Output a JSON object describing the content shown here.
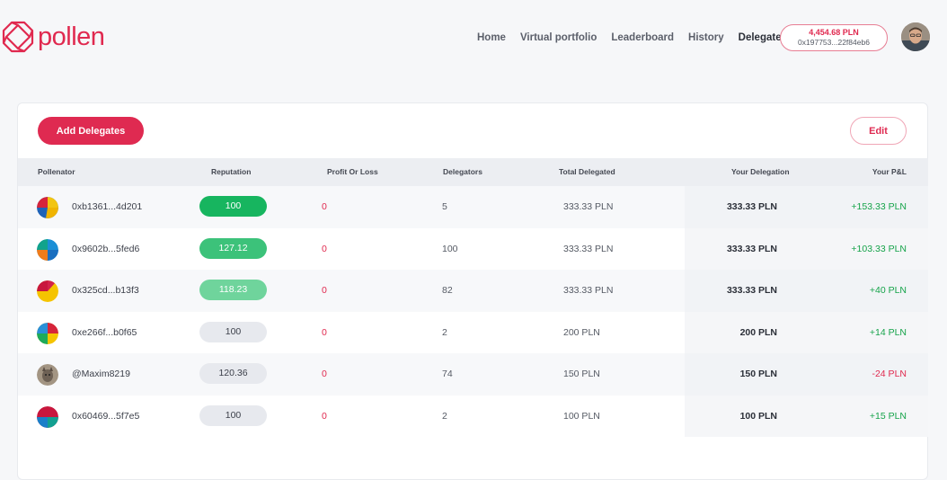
{
  "brand": {
    "name": "pollen",
    "color": "#e0294f"
  },
  "nav": [
    {
      "label": "Home",
      "active": false
    },
    {
      "label": "Virtual portfolio",
      "active": false
    },
    {
      "label": "Leaderboard",
      "active": false
    },
    {
      "label": "History",
      "active": false
    },
    {
      "label": "Delegate",
      "active": true
    }
  ],
  "wallet": {
    "balance": "4,454.68 PLN",
    "address": "0x197753...22f84eb6"
  },
  "toolbar": {
    "add_label": "Add Delegates",
    "edit_label": "Edit"
  },
  "table": {
    "headers": {
      "pollenator": "Pollenator",
      "reputation": "Reputation",
      "pnl": "Profit Or Loss",
      "delegators": "Delegators",
      "total": "Total Delegated",
      "your_delegation": "Your Delegation",
      "your_pnl": "Your P&L"
    },
    "rows": [
      {
        "name": "0xb1361...4d201",
        "reputation": "100",
        "rep_level": "high",
        "pnl": "0",
        "delegators": "5",
        "total": "333.33 PLN",
        "your_delegation": "333.33 PLN",
        "your_pnl": "+153.33 PLN",
        "trend": "pos",
        "avatar": "pie-a"
      },
      {
        "name": "0x9602b...5fed6",
        "reputation": "127.12",
        "rep_level": "mid",
        "pnl": "0",
        "delegators": "100",
        "total": "333.33 PLN",
        "your_delegation": "333.33 PLN",
        "your_pnl": "+103.33 PLN",
        "trend": "pos",
        "avatar": "pie-b"
      },
      {
        "name": "0x325cd...b13f3",
        "reputation": "118.23",
        "rep_level": "low",
        "pnl": "0",
        "delegators": "82",
        "total": "333.33 PLN",
        "your_delegation": "333.33 PLN",
        "your_pnl": "+40 PLN",
        "trend": "pos",
        "avatar": "pie-c"
      },
      {
        "name": "0xe266f...b0f65",
        "reputation": "100",
        "rep_level": "none",
        "pnl": "0",
        "delegators": "2",
        "total": "200 PLN",
        "your_delegation": "200 PLN",
        "your_pnl": "+14 PLN",
        "trend": "pos",
        "avatar": "pie-d"
      },
      {
        "name": "@Maxim8219",
        "reputation": "120.36",
        "rep_level": "none",
        "pnl": "0",
        "delegators": "74",
        "total": "150 PLN",
        "your_delegation": "150 PLN",
        "your_pnl": "-24 PLN",
        "trend": "neg",
        "avatar": "photo"
      },
      {
        "name": "0x60469...5f7e5",
        "reputation": "100",
        "rep_level": "none",
        "pnl": "0",
        "delegators": "2",
        "total": "100 PLN",
        "your_delegation": "100 PLN",
        "your_pnl": "+15 PLN",
        "trend": "pos",
        "avatar": "pie-e"
      }
    ]
  }
}
